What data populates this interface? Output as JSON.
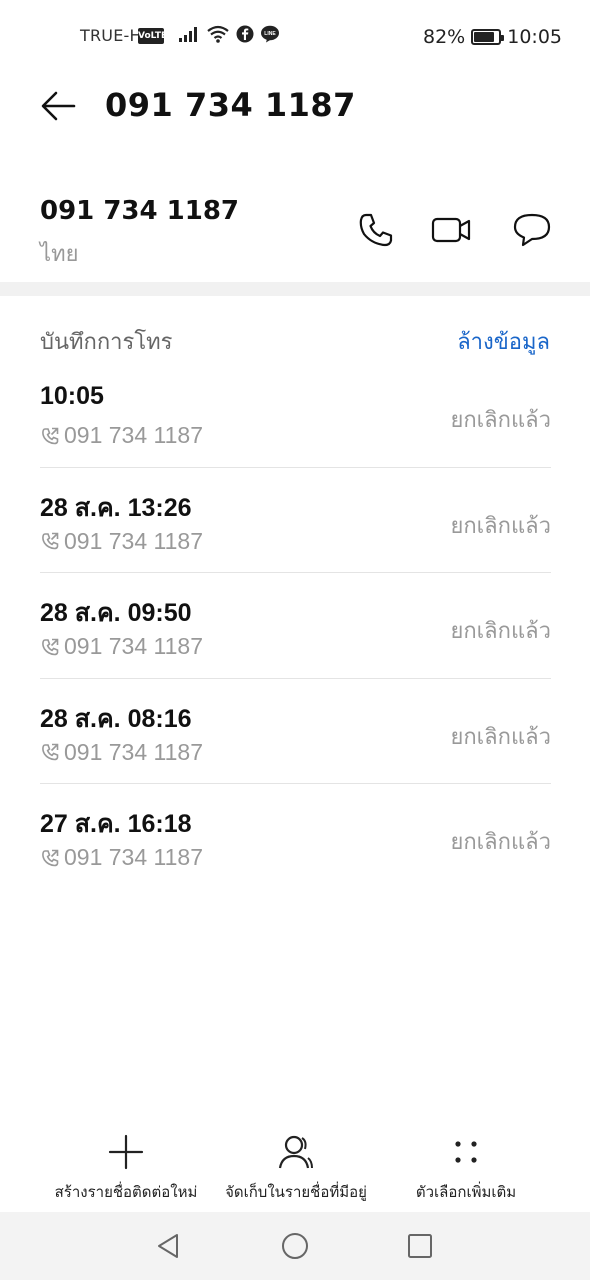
{
  "status_bar": {
    "carrier": "TRUE-H",
    "volte": "VoLTE",
    "battery_percent": "82%",
    "time": "10:05",
    "icons": [
      "signal-icon",
      "wifi-icon",
      "facebook-icon",
      "line-icon"
    ]
  },
  "header": {
    "title": "091 734 1187"
  },
  "contact": {
    "number": "091 734 1187",
    "region": "ไทย",
    "actions": [
      "phone-icon",
      "video-call-icon",
      "message-icon"
    ]
  },
  "call_log": {
    "title": "บันทึกการโทร",
    "clear_label": "ล้างข้อมูล",
    "entries": [
      {
        "time": "10:05",
        "number": "091 734 1187",
        "status": "ยกเลิกแล้ว"
      },
      {
        "time": "28 ส.ค. 13:26",
        "number": "091 734 1187",
        "status": "ยกเลิกแล้ว"
      },
      {
        "time": "28 ส.ค. 09:50",
        "number": "091 734 1187",
        "status": "ยกเลิกแล้ว"
      },
      {
        "time": "28 ส.ค. 08:16",
        "number": "091 734 1187",
        "status": "ยกเลิกแล้ว"
      },
      {
        "time": "27 ส.ค. 16:18",
        "number": "091 734 1187",
        "status": "ยกเลิกแล้ว"
      }
    ]
  },
  "toolbar": {
    "new_contact": "สร้างรายชื่อติดต่อใหม่",
    "save_existing": "จัดเก็บในรายชื่อที่มีอยู่",
    "more_options": "ตัวเลือกเพิ่มเติม"
  },
  "colors": {
    "accent": "#1a66c9",
    "secondary_text": "#999999",
    "divider": "#e4e4e4"
  }
}
